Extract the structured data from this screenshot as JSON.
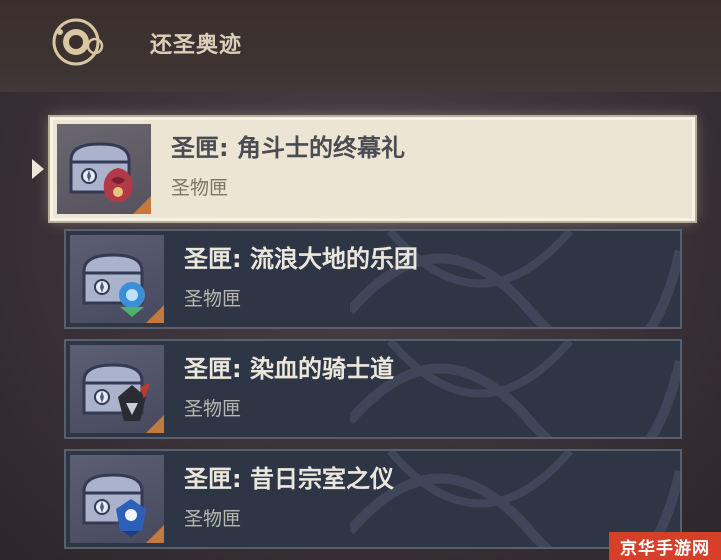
{
  "header": {
    "title": "还圣奥迹",
    "icon": "artifact-domain-icon"
  },
  "items": [
    {
      "title": "圣匣: 角斗士的终幕礼",
      "subtitle": "圣物匣",
      "icon": "chest-icon",
      "accent": "#b23a48",
      "selected": true
    },
    {
      "title": "圣匣: 流浪大地的乐团",
      "subtitle": "圣物匣",
      "icon": "chest-icon",
      "accent": "#3a8fd6",
      "selected": false
    },
    {
      "title": "圣匣: 染血的骑士道",
      "subtitle": "圣物匣",
      "icon": "chest-icon",
      "accent": "#2b2b33",
      "selected": false
    },
    {
      "title": "圣匣: 昔日宗室之仪",
      "subtitle": "圣物匣",
      "icon": "chest-icon",
      "accent": "#2d5fb8",
      "selected": false
    }
  ],
  "colors": {
    "card_bg": "#2e3545",
    "selected_bg": "#ece5d4",
    "rarity_corner": "#c47a3f",
    "watermark_bg": "#d6402a"
  },
  "watermark": "京华手游网"
}
